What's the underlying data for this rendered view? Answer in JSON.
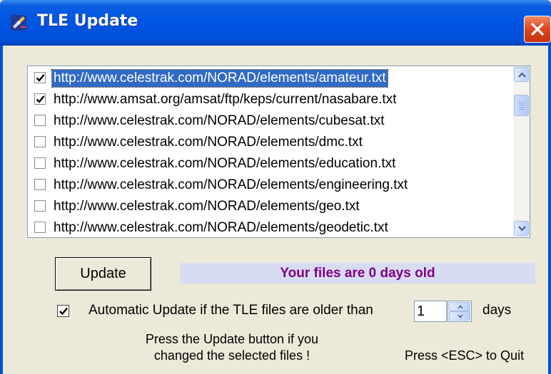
{
  "window": {
    "title": "TLE Update",
    "colors": {
      "titlebar": "#0054e3",
      "close": "#e04a1f",
      "face": "#ece9d8",
      "selection": "#316ac5",
      "status_text": "#800080",
      "status_bg": "#d8dcf3"
    }
  },
  "list": {
    "items": [
      {
        "url": "http://www.celestrak.com/NORAD/elements/amateur.txt",
        "checked": true,
        "selected": true
      },
      {
        "url": "http://www.amsat.org/amsat/ftp/keps/current/nasabare.txt",
        "checked": true,
        "selected": false
      },
      {
        "url": "http://www.celestrak.com/NORAD/elements/cubesat.txt",
        "checked": false,
        "selected": false
      },
      {
        "url": "http://www.celestrak.com/NORAD/elements/dmc.txt",
        "checked": false,
        "selected": false
      },
      {
        "url": "http://www.celestrak.com/NORAD/elements/education.txt",
        "checked": false,
        "selected": false
      },
      {
        "url": "http://www.celestrak.com/NORAD/elements/engineering.txt",
        "checked": false,
        "selected": false
      },
      {
        "url": "http://www.celestrak.com/NORAD/elements/geo.txt",
        "checked": false,
        "selected": false
      },
      {
        "url": "http://www.celestrak.com/NORAD/elements/geodetic.txt",
        "checked": false,
        "selected": false
      }
    ]
  },
  "controls": {
    "update_label": "Update",
    "status_text": "Your files are 0 days old",
    "auto_update_checked": true,
    "auto_update_label": "Automatic Update if the TLE files are older than",
    "days_value": "1",
    "days_label": "days",
    "hint_line1": "Press the Update button if you",
    "hint_line2": "changed the selected files !",
    "esc_hint": "Press <ESC> to Quit"
  }
}
